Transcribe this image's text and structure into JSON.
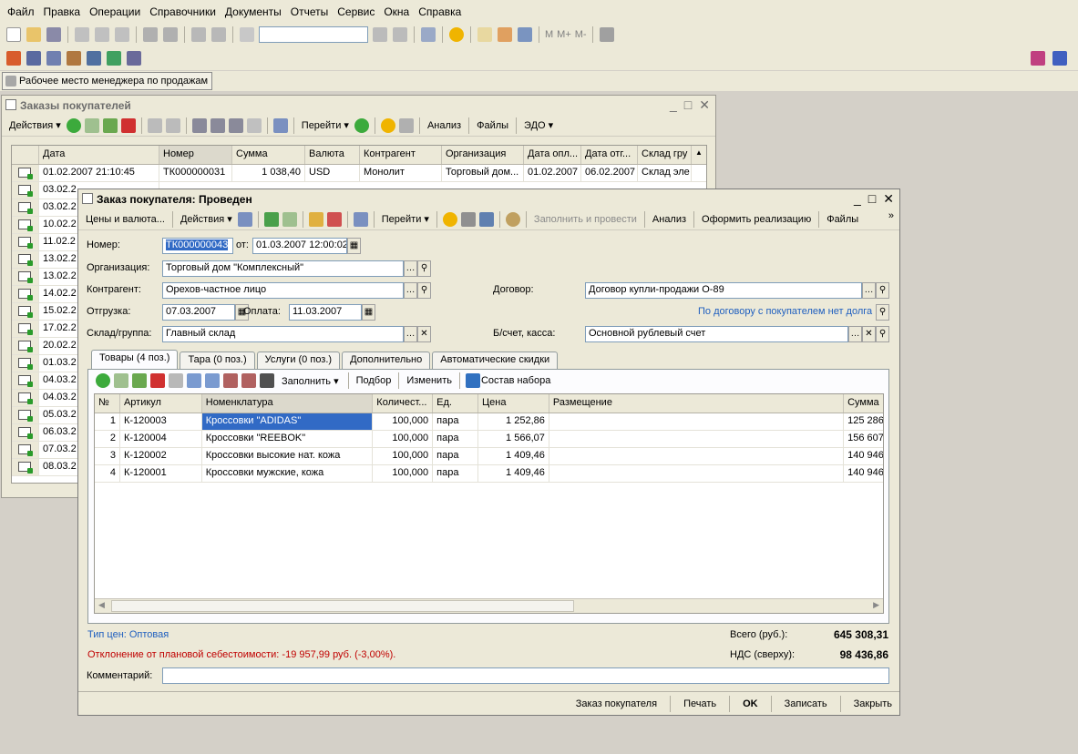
{
  "menu": [
    "Файл",
    "Правка",
    "Операции",
    "Справочники",
    "Документы",
    "Отчеты",
    "Сервис",
    "Окна",
    "Справка"
  ],
  "toolbar1": {
    "mem": [
      "M",
      "M+",
      "M-"
    ]
  },
  "panel": {
    "button_label": "Рабочее место менеджера по продажам"
  },
  "list_window": {
    "title": "Заказы покупателей",
    "toolbar": [
      "Действия",
      "Перейти",
      "Анализ",
      "Файлы",
      "ЭДО"
    ],
    "columns": [
      "Дата",
      "Номер",
      "Сумма",
      "Валюта",
      "Контрагент",
      "Организация",
      "Дата опл...",
      "Дата отг...",
      "Склад гру"
    ],
    "rows": [
      [
        "01.02.2007 21:10:45",
        "ТК000000031",
        "1 038,40",
        "USD",
        "Монолит",
        "Торговый дом...",
        "01.02.2007",
        "06.02.2007",
        "Склад эле"
      ],
      [
        "03.02.2"
      ],
      [
        "03.02.2"
      ],
      [
        "10.02.2"
      ],
      [
        "11.02.2"
      ],
      [
        "13.02.2"
      ],
      [
        "13.02.2"
      ],
      [
        "14.02.2"
      ],
      [
        "15.02.2"
      ],
      [
        "17.02.2"
      ],
      [
        "20.02.2"
      ],
      [
        "01.03.2"
      ],
      [
        "04.03.2"
      ],
      [
        "04.03.2"
      ],
      [
        "05.03.2"
      ],
      [
        "06.03.2"
      ],
      [
        "07.03.2"
      ],
      [
        "08.03.2"
      ]
    ]
  },
  "order_window": {
    "title": "Заказ покупателя: Проведен",
    "toolbar": [
      "Цены и валюта...",
      "Действия",
      "Перейти",
      "Заполнить и провести",
      "Анализ",
      "Оформить реализацию",
      "Файлы"
    ],
    "labels": {
      "number": "Номер:",
      "from": "от:",
      "org": "Организация:",
      "contractor": "Контрагент:",
      "contract": "Договор:",
      "shipment": "Отгрузка:",
      "payment": "Оплата:",
      "warehouse": "Склад/группа:",
      "account": "Б/счет, касса:"
    },
    "values": {
      "number": "ТК000000043",
      "date": "01.03.2007 12:00:02",
      "org": "Торговый дом \"Комплексный\"",
      "contractor": "Орехов-частное лицо",
      "contract": "Договор купли-продажи О-89",
      "shipment": "07.03.2007",
      "payment": "11.03.2007",
      "warehouse": "Главный склад",
      "account": "Основной рублевый счет",
      "debt_link": "По договору с покупателем нет долга"
    },
    "tabs": [
      "Товары (4 поз.)",
      "Тара (0 поз.)",
      "Услуги (0 поз.)",
      "Дополнительно",
      "Автоматические скидки"
    ],
    "tab_toolbar": [
      "Заполнить",
      "Подбор",
      "Изменить",
      "Состав набора"
    ],
    "columns": [
      "№",
      "Артикул",
      "Номенклатура",
      "Количест...",
      "Ед.",
      "Цена",
      "Размещение",
      "Сумма"
    ],
    "items": [
      {
        "n": "1",
        "art": "К-120003",
        "name": "Кроссовки \"ADIDAS\"",
        "qty": "100,000",
        "unit": "пара",
        "price": "1 252,86",
        "sum": "125 286"
      },
      {
        "n": "2",
        "art": "К-120004",
        "name": "Кроссовки \"REEBOK\"",
        "qty": "100,000",
        "unit": "пара",
        "price": "1 566,07",
        "sum": "156 607"
      },
      {
        "n": "3",
        "art": "К-120002",
        "name": "Кроссовки высокие нат. кожа",
        "qty": "100,000",
        "unit": "пара",
        "price": "1 409,46",
        "sum": "140 946"
      },
      {
        "n": "4",
        "art": "К-120001",
        "name": "Кроссовки мужские, кожа",
        "qty": "100,000",
        "unit": "пара",
        "price": "1 409,46",
        "sum": "140 946"
      }
    ],
    "price_type": "Тип цен: Оптовая",
    "deviation": "Отклонение от плановой себестоимости: -19 957,99 руб. (-3,00%).",
    "total_label": "Всего (руб.):",
    "total_value": "645 308,31",
    "vat_label": "НДС (сверху):",
    "vat_value": "98 436,86",
    "comment_label": "Комментарий:",
    "bottom": [
      "Заказ покупателя",
      "Печать",
      "OK",
      "Записать",
      "Закрыть"
    ]
  }
}
